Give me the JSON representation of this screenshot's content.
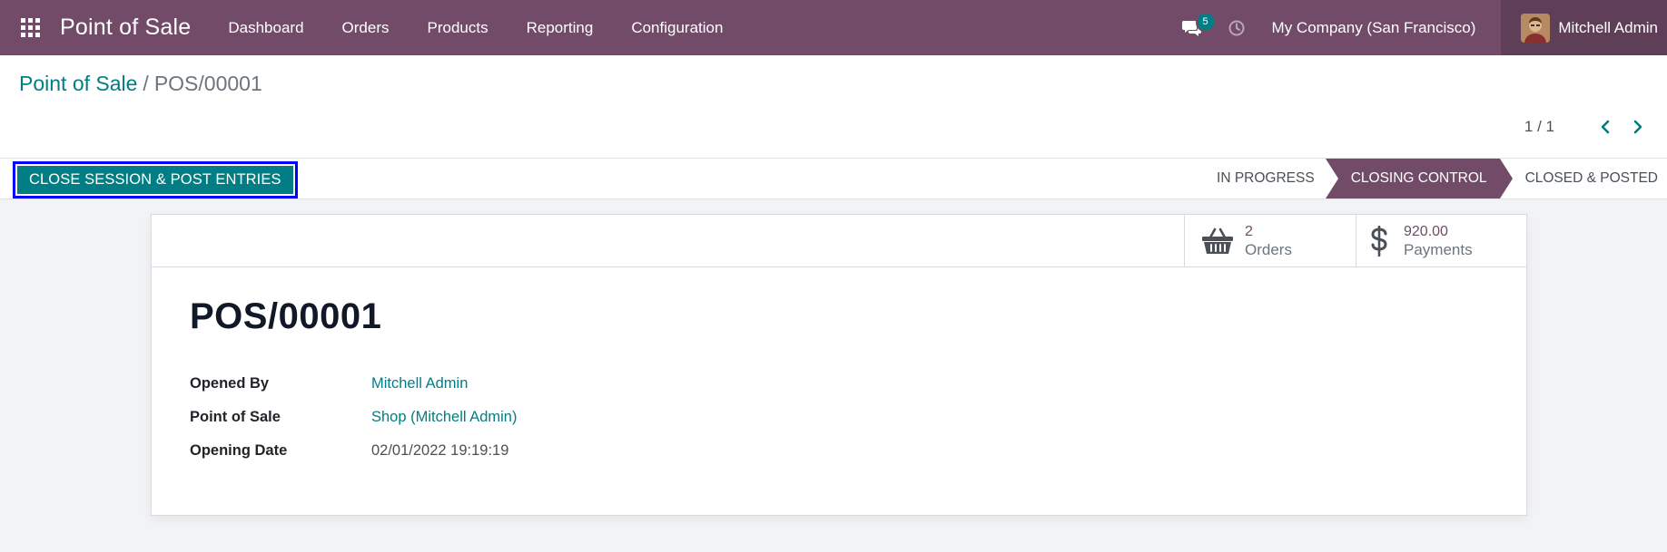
{
  "navbar": {
    "brand": "Point of Sale",
    "menu": [
      "Dashboard",
      "Orders",
      "Products",
      "Reporting",
      "Configuration"
    ],
    "chat_count": "5",
    "company": "My Company (San Francisco)",
    "user": "Mitchell Admin",
    "bg_color": "#714b67"
  },
  "breadcrumb": {
    "parent": "Point of Sale",
    "separator": "/",
    "current": "POS/00001"
  },
  "pager": {
    "value": "1 / 1"
  },
  "statusbar": {
    "action_button": "CLOSE SESSION & POST ENTRIES",
    "stages": [
      "IN PROGRESS",
      "CLOSING CONTROL",
      "CLOSED & POSTED"
    ],
    "active_stage": "CLOSING CONTROL"
  },
  "smart_buttons": {
    "orders": {
      "value": "2",
      "label": "Orders",
      "icon": "basket-icon"
    },
    "payments": {
      "value": "920.00",
      "label": "Payments",
      "icon": "dollar-icon"
    }
  },
  "record": {
    "title": "POS/00001",
    "fields": [
      {
        "label": "Opened By",
        "value": "Mitchell Admin"
      },
      {
        "label": "Point of Sale",
        "value": "Shop (Mitchell Admin)"
      },
      {
        "label": "Opening Date",
        "value": "02/01/2022 19:19:19"
      }
    ]
  },
  "colors": {
    "primary": "#714b67",
    "accent": "#017e84"
  }
}
